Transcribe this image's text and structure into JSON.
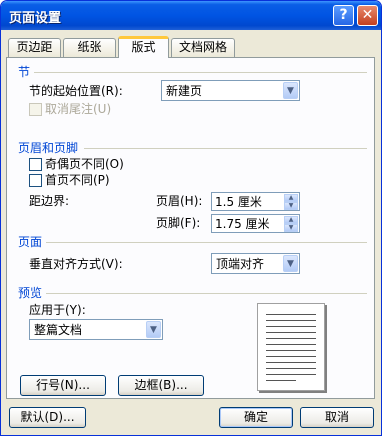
{
  "window": {
    "title": "页面设置",
    "help_glyph": "?",
    "close_glyph": "✕"
  },
  "tabs": [
    {
      "label": "页边距"
    },
    {
      "label": "纸张"
    },
    {
      "label": "版式",
      "active": true
    },
    {
      "label": "文档网格"
    }
  ],
  "section_section": {
    "header": "节",
    "start_label": "节的起始位置(R):",
    "start_value": "新建页",
    "suppress_endnotes_label": "取消尾注(U)",
    "suppress_endnotes_checked": false,
    "suppress_endnotes_disabled": true
  },
  "headers_footers": {
    "header": "页眉和页脚",
    "odd_even_label": "奇偶页不同(O)",
    "odd_even_checked": false,
    "first_page_label": "首页不同(P)",
    "first_page_checked": false,
    "from_edge_label": "距边界:",
    "header_label": "页眉(H):",
    "header_value": "1.5 厘米",
    "footer_label": "页脚(F):",
    "footer_value": "1.75 厘米"
  },
  "page": {
    "header": "页面",
    "vertical_align_label": "垂直对齐方式(V):",
    "vertical_align_value": "顶端对齐"
  },
  "preview": {
    "header": "预览",
    "apply_to_label": "应用于(Y):",
    "apply_to_value": "整篇文档"
  },
  "buttons": {
    "line_numbers": "行号(N)...",
    "borders": "边框(B)...",
    "default": "默认(D)...",
    "ok": "确定",
    "cancel": "取消"
  },
  "icons": {
    "dropdown": "▼",
    "spin_up": "▲",
    "spin_down": "▼"
  },
  "colors": {
    "title_bar": "#0054e3",
    "section_header": "#0046d5",
    "active_tab_accent": "#ffc83c",
    "dialog_bg": "#ece9d8"
  }
}
